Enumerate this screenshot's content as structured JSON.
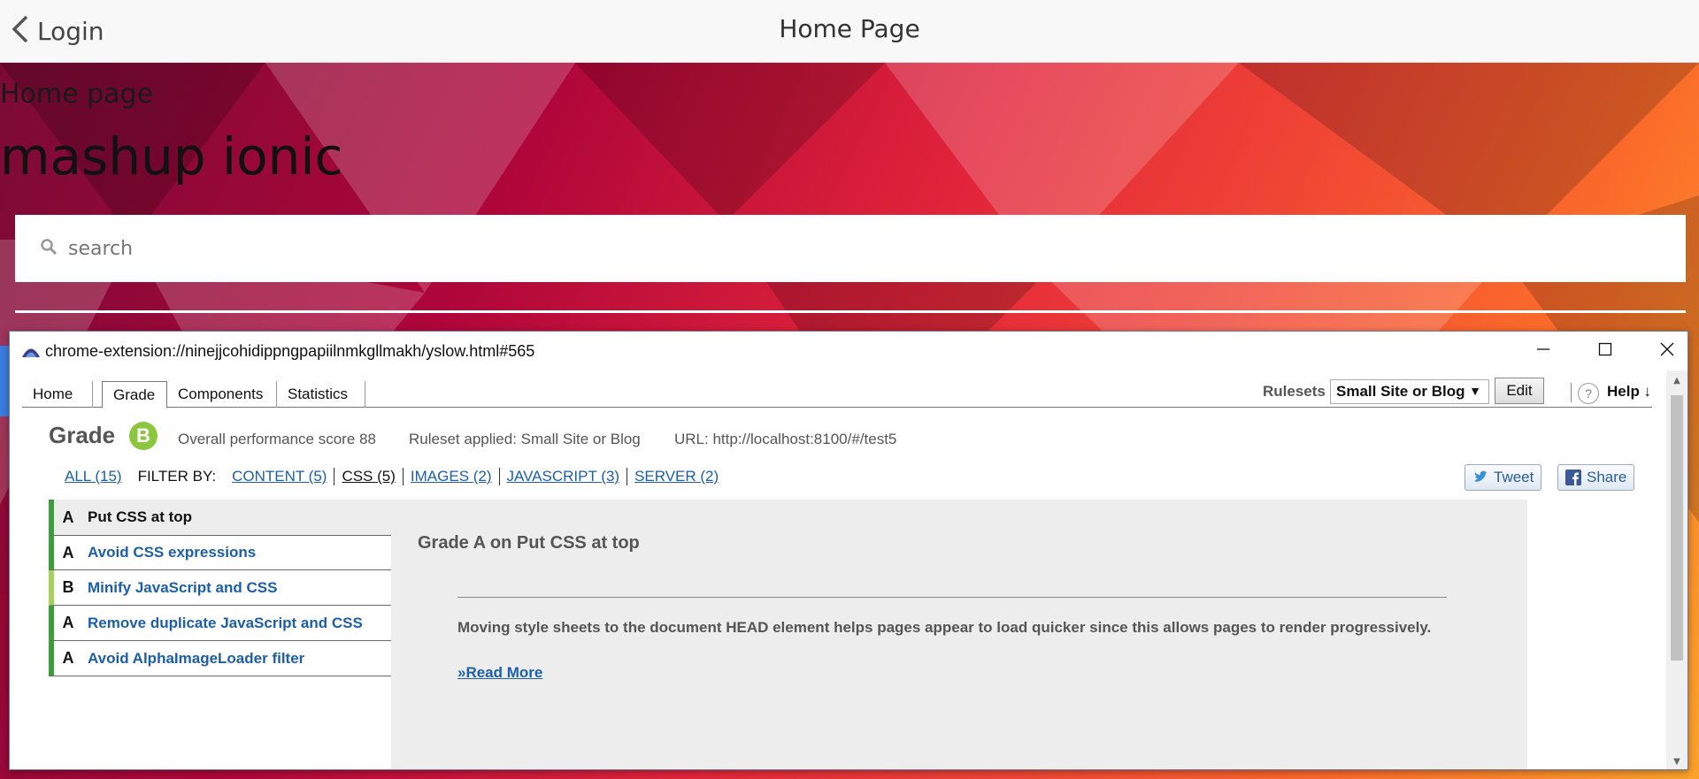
{
  "header": {
    "back_label": "Login",
    "title": "Home Page"
  },
  "hero": {
    "subtitle": "Home page",
    "title": "mashup ionic"
  },
  "search": {
    "placeholder": "search"
  },
  "popup": {
    "url": "chrome-extension://ninejjcohidippngpapiilnmkgllmakh/yslow.html#565",
    "tabs": [
      {
        "label": "Home"
      },
      {
        "label": "Grade"
      },
      {
        "label": "Components"
      },
      {
        "label": "Statistics"
      }
    ],
    "rulesets_label": "Rulesets",
    "ruleset_selected": "Small Site or Blog",
    "edit_label": "Edit",
    "help_icon_text": "?",
    "help_label": "Help ↓",
    "grade_label": "Grade",
    "grade_letter": "B",
    "score_text": "Overall performance score 88",
    "ruleset_text": "Ruleset applied: Small Site or Blog",
    "url_text": "URL: http://localhost:8100/#/test5",
    "filter": {
      "all": "ALL (15)",
      "label": "FILTER BY:",
      "items": [
        "CONTENT (5)",
        "CSS (5)",
        "IMAGES (2)",
        "JAVASCRIPT (3)",
        "SERVER (2)"
      ]
    },
    "tweet_label": "Tweet",
    "share_label": "Share",
    "rules": [
      {
        "grade": "A",
        "name": "Put CSS at top"
      },
      {
        "grade": "A",
        "name": "Avoid CSS expressions"
      },
      {
        "grade": "B",
        "name": "Minify JavaScript and CSS"
      },
      {
        "grade": "A",
        "name": "Remove duplicate JavaScript and CSS"
      },
      {
        "grade": "A",
        "name": "Avoid AlphaImageLoader filter"
      }
    ],
    "detail": {
      "title": "Grade A on Put CSS at top",
      "description": "Moving style sheets to the document HEAD element helps pages appear to load quicker since this allows pages to render progressively.",
      "read_more": "»Read More"
    }
  },
  "colors": {
    "grade_badge": "#8cc63f",
    "grade_a_bar": "#3a9e3a",
    "grade_b_bar": "#a8cf5a",
    "link": "#1c5fa8"
  }
}
